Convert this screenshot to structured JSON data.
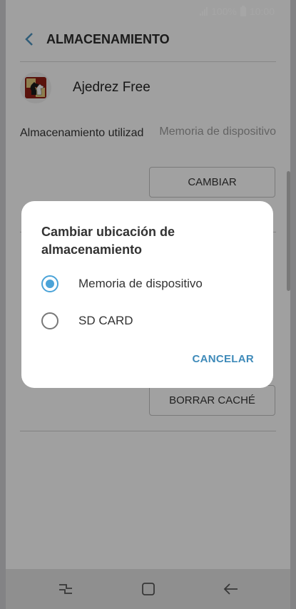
{
  "status_bar": {
    "battery": "100%",
    "time": "10:00"
  },
  "header": {
    "title": "ALMACENAMIENTO"
  },
  "app": {
    "name": "Ajedrez Free"
  },
  "storage": {
    "label": "Almacenamiento utilizad",
    "value": "Memoria de dispositivo",
    "change_button": "CAMBIAR"
  },
  "cache": {
    "clear_button": "BORRAR CACHÉ"
  },
  "dialog": {
    "title": "Cambiar ubicación de almacenamiento",
    "options": [
      {
        "label": "Memoria de dispositivo",
        "selected": true
      },
      {
        "label": "SD CARD",
        "selected": false
      }
    ],
    "cancel_label": "CANCELAR"
  },
  "colors": {
    "accent": "#4aa3d8",
    "cancel": "#3e8ab9"
  },
  "icons": {
    "back": "back-arrow-icon",
    "recents": "recents-icon",
    "home": "home-icon",
    "nav_back": "back-icon"
  }
}
